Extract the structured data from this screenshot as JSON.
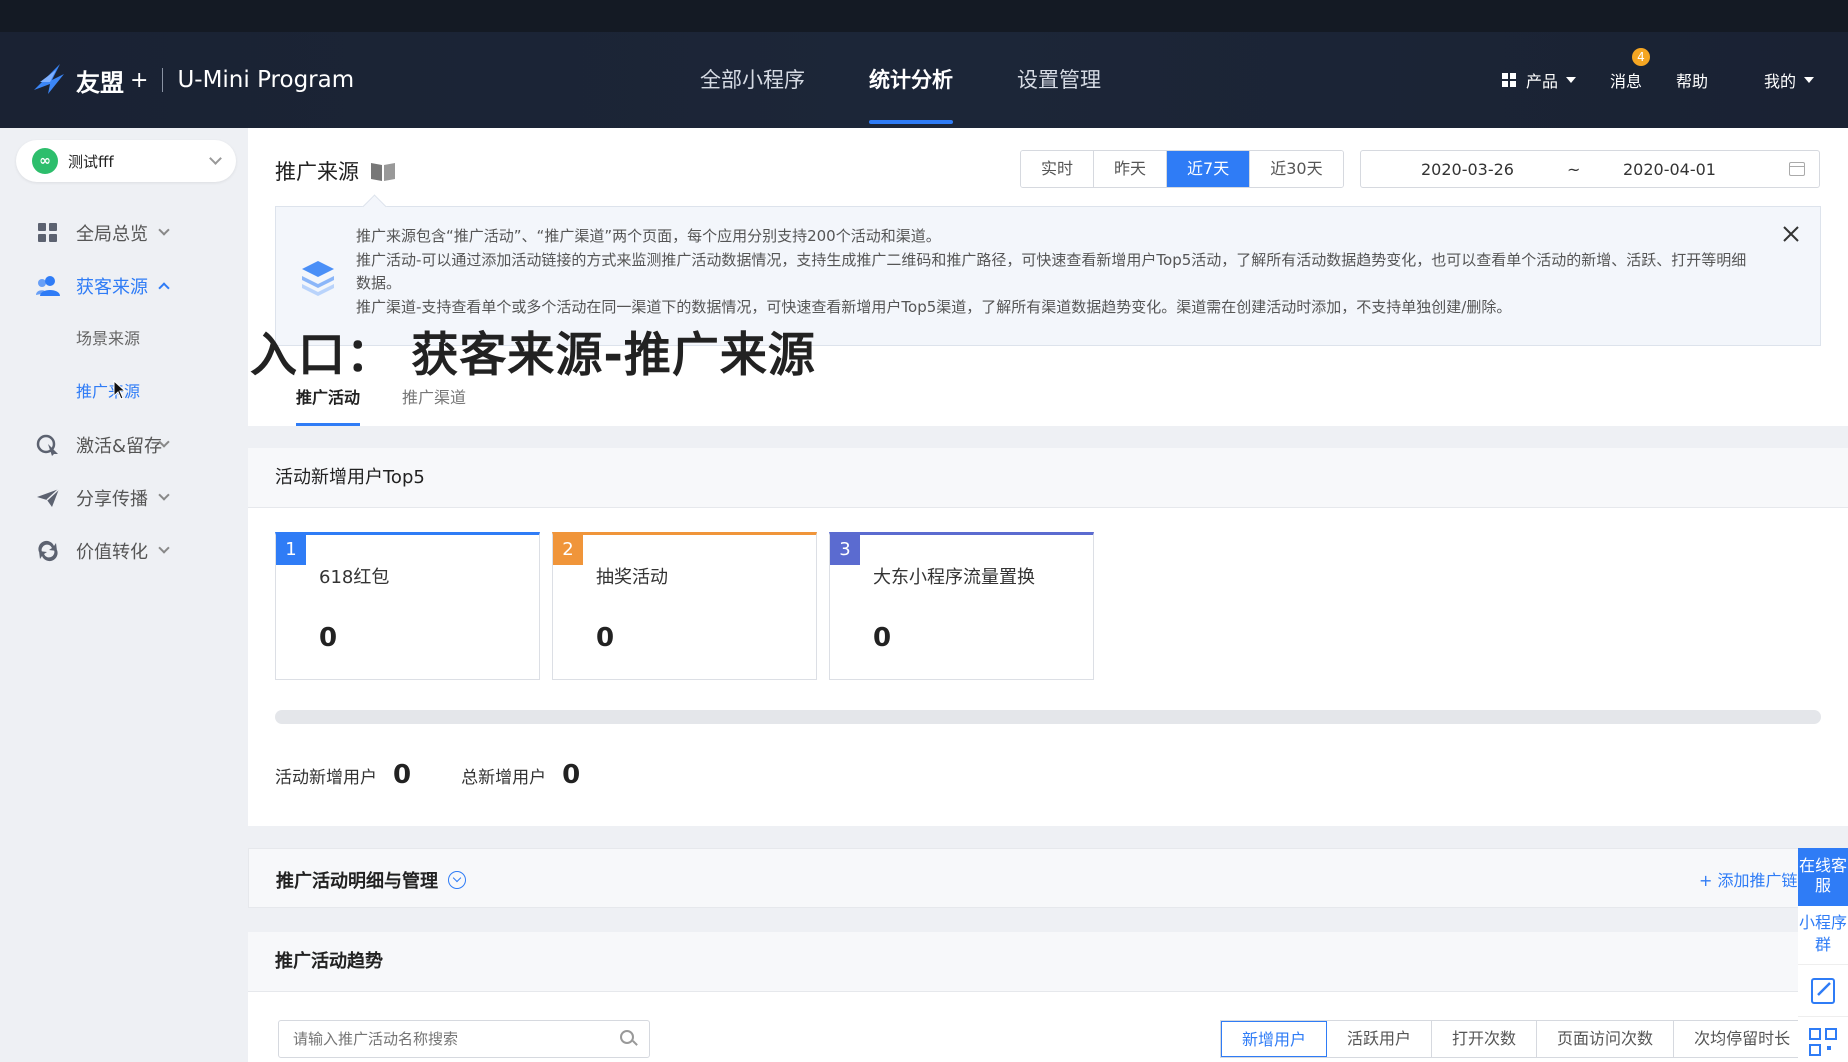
{
  "header": {
    "brand": "友盟",
    "brand_plus": "+",
    "product": "U-Mini Program",
    "nav": [
      "全部小程序",
      "统计分析",
      "设置管理"
    ],
    "products_label": "产品",
    "messages_label": "消息",
    "messages_badge": "4",
    "help_label": "帮助",
    "mine_label": "我的"
  },
  "sidebar": {
    "app_name": "测试fff",
    "items": [
      {
        "label": "全局总览"
      },
      {
        "label": "获客来源"
      },
      {
        "label": "激活&留存"
      },
      {
        "label": "分享传播"
      },
      {
        "label": "价值转化"
      }
    ],
    "sub_items": [
      "场景来源",
      "推广来源"
    ]
  },
  "page": {
    "title": "推广来源",
    "time_ranges": [
      "实时",
      "昨天",
      "近7天",
      "近30天"
    ],
    "date_start": "2020-03-26",
    "date_sep": "~",
    "date_end": "2020-04-01",
    "notice_lines": [
      "推广来源包含“推广活动”、“推广渠道”两个页面，每个应用分别支持200个活动和渠道。",
      "推广活动-可以通过添加活动链接的方式来监测推广活动数据情况，支持生成推广二维码和推广路径，可快速查看新增用户Top5活动，了解所有活动数据趋势变化，也可以查看单个活动的新增、活跃、打开等明细数据。",
      "推广渠道-支持查看单个或多个活动在同一渠道下的数据情况，可快速查看新增用户Top5渠道，了解所有渠道数据趋势变化。渠道需在创建活动时添加，不支持单独创建/删除。"
    ],
    "overlay_caption": "入口： 获客来源-推广来源",
    "tabs": [
      "推广活动",
      "推广渠道"
    ]
  },
  "top5": {
    "title": "活动新增用户Top5",
    "cards": [
      {
        "rank": "1",
        "name": "618红包",
        "value": "0",
        "color": "#2f7cf6"
      },
      {
        "rank": "2",
        "name": "抽奖活动",
        "value": "0",
        "color": "#f0953a"
      },
      {
        "rank": "3",
        "name": "大东小程序流量置换",
        "value": "0",
        "color": "#5b6bd0"
      }
    ],
    "activity_new_label": "活动新增用户",
    "activity_new_value": "0",
    "total_new_label": "总新增用户",
    "total_new_value": "0"
  },
  "detail": {
    "title": "推广活动明细与管理",
    "add_label": "+ 添加推广链"
  },
  "trend": {
    "title": "推广活动趋势",
    "search_placeholder": "请输入推广活动名称搜索",
    "metrics": [
      "新增用户",
      "活跃用户",
      "打开次数",
      "页面访问次数",
      "次均停留时长"
    ]
  },
  "float": {
    "customer_service": "在线客服",
    "group": "小程序群"
  },
  "colors": {
    "accent": "#2f7cf6",
    "header_bg": "#1a2233"
  }
}
